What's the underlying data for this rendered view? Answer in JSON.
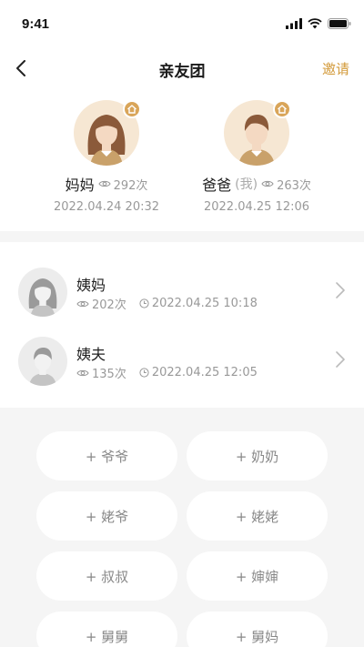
{
  "status_bar": {
    "time": "9:41"
  },
  "nav": {
    "title": "亲友团",
    "invite_label": "邀请"
  },
  "top_members": [
    {
      "name": "妈妈",
      "me_tag": "",
      "views": "292次",
      "time": "2022.04.24 20:32"
    },
    {
      "name": "爸爸",
      "me_tag": "(我)",
      "views": "263次",
      "time": "2022.04.25 12:06"
    }
  ],
  "members": [
    {
      "name": "姨妈",
      "views": "202次",
      "time": "2022.04.25 10:18"
    },
    {
      "name": "姨夫",
      "views": "135次",
      "time": "2022.04.25 12:05"
    }
  ],
  "add_buttons": [
    "+ 爷爷",
    "+ 奶奶",
    "+ 姥爷",
    "+ 姥姥",
    "+ 叔叔",
    "+ 婶婶",
    "+ 舅舅",
    "+ 舅妈"
  ],
  "colors": {
    "accent": "#d39a3a",
    "badge": "#d9a559",
    "avatar_bg": "#f6e7d3",
    "band": "#f5f5f5"
  }
}
